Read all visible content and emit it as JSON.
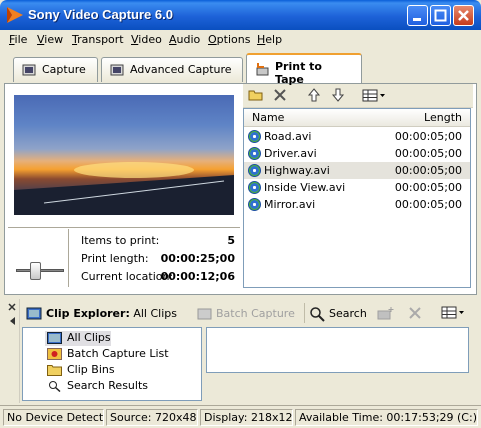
{
  "window": {
    "title": "Sony Video Capture 6.0"
  },
  "menu": [
    {
      "label": "File",
      "u": "F",
      "rest": "ile"
    },
    {
      "label": "View",
      "u": "V",
      "rest": "iew"
    },
    {
      "label": "Transport",
      "u": "T",
      "rest": "ransport"
    },
    {
      "label": "Video",
      "u": "V",
      "rest": "ideo"
    },
    {
      "label": "Audio",
      "u": "A",
      "rest": "udio"
    },
    {
      "label": "Options",
      "u": "O",
      "rest": "ptions"
    },
    {
      "label": "Help",
      "u": "H",
      "rest": "elp"
    }
  ],
  "tabs": {
    "capture": "Capture",
    "advanced": "Advanced Capture",
    "print": "Print to Tape",
    "active": "Print to Tape"
  },
  "stats": {
    "items_label": "Items to print:",
    "items_value": "5",
    "length_label": "Print length:",
    "length_value": "00:00:25;00",
    "location_label": "Current location:",
    "location_value": "00:00:12;06"
  },
  "list": {
    "col_name": "Name",
    "col_length": "Length",
    "rows": [
      {
        "name": "Road.avi",
        "length": "00:00:05;00"
      },
      {
        "name": "Driver.avi",
        "length": "00:00:05;00"
      },
      {
        "name": "Highway.avi",
        "length": "00:00:05;00"
      },
      {
        "name": "Inside View.avi",
        "length": "00:00:05;00"
      },
      {
        "name": "Mirror.avi",
        "length": "00:00:05;00"
      }
    ]
  },
  "explorer": {
    "title_bold": "Clip Explorer:",
    "title_rest": "All Clips",
    "batch_capture": "Batch Capture",
    "search": "Search",
    "tree": [
      "All Clips",
      "Batch Capture List",
      "Clip Bins",
      "Search Results"
    ]
  },
  "status": {
    "device": "No Device Detected",
    "source": "Source: 720x480",
    "display": "Display: 218x120",
    "available": "Available Time: 00:17:53;29 (C:)"
  }
}
